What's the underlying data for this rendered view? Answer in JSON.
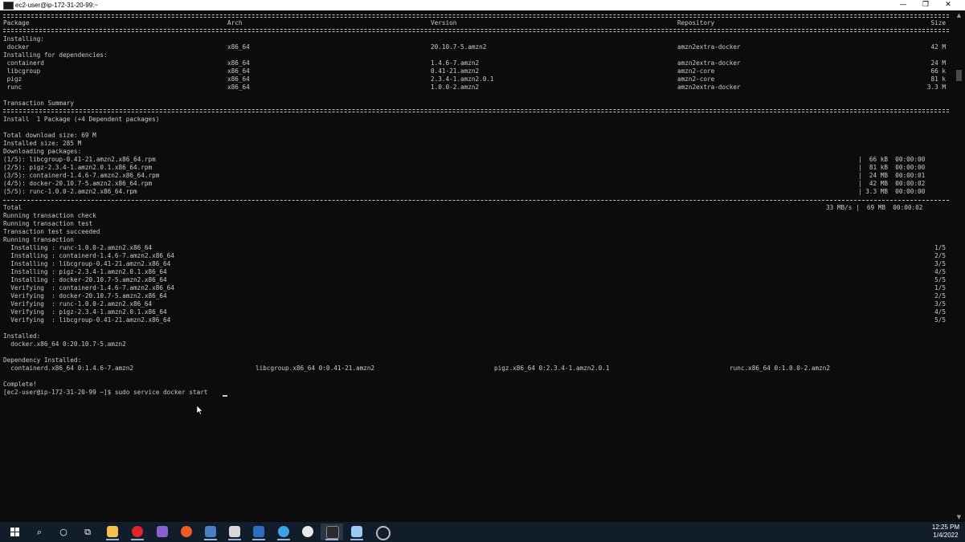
{
  "window": {
    "title": "ec2-user@ip-172-31-20-99:~",
    "controls": {
      "minimize": "—",
      "maximize": "❐",
      "close": "✕"
    }
  },
  "table_header": {
    "package": "Package",
    "arch": "Arch",
    "version": "Version",
    "repository": "Repository",
    "size": "Size"
  },
  "installing_label": "Installing:",
  "main_package": {
    "name": " docker",
    "arch": "x86_64",
    "version": "20.10.7-5.amzn2",
    "repo": "amzn2extra-docker",
    "size": "42 M"
  },
  "deps_label": "Installing for dependencies:",
  "dependencies": [
    {
      "name": " containerd",
      "arch": "x86_64",
      "version": "1.4.6-7.amzn2",
      "repo": "amzn2extra-docker",
      "size": "24 M"
    },
    {
      "name": " libcgroup",
      "arch": "x86_64",
      "version": "0.41-21.amzn2",
      "repo": "amzn2-core",
      "size": "66 k"
    },
    {
      "name": " pigz",
      "arch": "x86_64",
      "version": "2.3.4-1.amzn2.0.1",
      "repo": "amzn2-core",
      "size": "81 k"
    },
    {
      "name": " runc",
      "arch": "x86_64",
      "version": "1.0.0-2.amzn2",
      "repo": "amzn2extra-docker",
      "size": "3.3 M"
    }
  ],
  "transaction_summary": "Transaction Summary",
  "install_summary": "Install  1 Package (+4 Dependent packages)",
  "total_download": "Total download size: 69 M",
  "installed_size": "Installed size: 285 M",
  "downloading": "Downloading packages:",
  "downloads": [
    {
      "file": "(1/5): libcgroup-0.41-21.amzn2.x86_64.rpm",
      "stats": "|  66 kB  00:00:00"
    },
    {
      "file": "(2/5): pigz-2.3.4-1.amzn2.0.1.x86_64.rpm",
      "stats": "|  81 kB  00:00:00"
    },
    {
      "file": "(3/5): containerd-1.4.6-7.amzn2.x86_64.rpm",
      "stats": "|  24 MB  00:00:01"
    },
    {
      "file": "(4/5): docker-20.10.7-5.amzn2.x86_64.rpm",
      "stats": "|  42 MB  00:00:02"
    },
    {
      "file": "(5/5): runc-1.0.0-2.amzn2.x86_64.rpm",
      "stats": "| 3.3 MB  00:00:00"
    }
  ],
  "total": {
    "label": "Total",
    "stats": "33 MB/s |  69 MB  00:00:02"
  },
  "transaction_lines": [
    "Running transaction check",
    "Running transaction test",
    "Transaction test succeeded",
    "Running transaction"
  ],
  "steps": [
    {
      "text": "  Installing : runc-1.0.0-2.amzn2.x86_64",
      "count": "1/5"
    },
    {
      "text": "  Installing : containerd-1.4.6-7.amzn2.x86_64",
      "count": "2/5"
    },
    {
      "text": "  Installing : libcgroup-0.41-21.amzn2.x86_64",
      "count": "3/5"
    },
    {
      "text": "  Installing : pigz-2.3.4-1.amzn2.0.1.x86_64",
      "count": "4/5"
    },
    {
      "text": "  Installing : docker-20.10.7-5.amzn2.x86_64",
      "count": "5/5"
    },
    {
      "text": "  Verifying  : containerd-1.4.6-7.amzn2.x86_64",
      "count": "1/5"
    },
    {
      "text": "  Verifying  : docker-20.10.7-5.amzn2.x86_64",
      "count": "2/5"
    },
    {
      "text": "  Verifying  : runc-1.0.0-2.amzn2.x86_64",
      "count": "3/5"
    },
    {
      "text": "  Verifying  : pigz-2.3.4-1.amzn2.0.1.x86_64",
      "count": "4/5"
    },
    {
      "text": "  Verifying  : libcgroup-0.41-21.amzn2.x86_64",
      "count": "5/5"
    }
  ],
  "installed_label": "Installed:",
  "installed_pkg": "  docker.x86_64 0:20.10.7-5.amzn2",
  "dep_installed_label": "Dependency Installed:",
  "dep_installed": [
    "  containerd.x86_64 0:1.4.6-7.amzn2",
    "libcgroup.x86_64 0:0.41-21.amzn2",
    "pigz.x86_64 0:2.3.4-1.amzn2.0.1",
    "runc.x86_64 0:1.0.0-2.amzn2"
  ],
  "complete": "Complete!",
  "prompt": "[ec2-user@ip-172-31-20-99 ~]$ sudo service docker start",
  "scrollbar": {
    "up": "▲",
    "down": "▼"
  },
  "taskbar": {
    "start_icon": "windows-start-icon",
    "search_glyph": "⌕",
    "cortana_glyph": "○",
    "taskview_glyph": "⧉",
    "apps": [
      {
        "name": "file-explorer-icon",
        "color": "#f2c14e"
      },
      {
        "name": "opera-icon",
        "color": "#e3222c"
      },
      {
        "name": "visual-studio-icon",
        "color": "#8a5fd1"
      },
      {
        "name": "postman-icon",
        "color": "#ef5b25"
      },
      {
        "name": "network-icon",
        "color": "#4a7fc1"
      },
      {
        "name": "unity-icon",
        "color": "#d8d8d8"
      },
      {
        "name": "powershell-icon",
        "color": "#2c6fbf"
      },
      {
        "name": "browser-icon",
        "color": "#3aa3e8"
      },
      {
        "name": "slack-icon",
        "color": "#e8e8e8"
      },
      {
        "name": "terminal-icon",
        "color": "#2b2b2b"
      },
      {
        "name": "notepad-icon",
        "color": "#9ec9f0"
      },
      {
        "name": "chrome-icon",
        "color": "#cfcfcf"
      }
    ],
    "time": "12:25 PM",
    "date": "1/4/2022"
  }
}
